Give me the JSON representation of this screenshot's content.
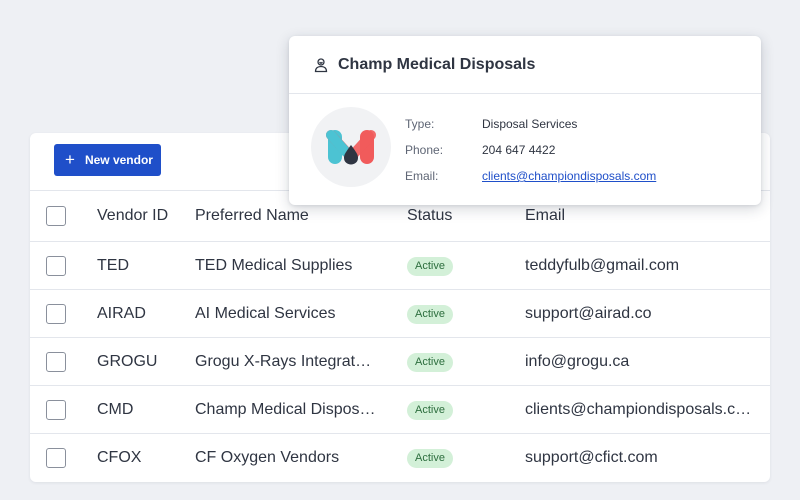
{
  "toolbar": {
    "new_vendor_label": "New vendor"
  },
  "table": {
    "columns": {
      "id": "Vendor ID",
      "name": "Preferred Name",
      "status": "Status",
      "email": "Email"
    },
    "rows": [
      {
        "id": "TED",
        "name": "TED Medical Supplies",
        "status": "Active",
        "email": "teddyfulb@gmail.com"
      },
      {
        "id": "AIRAD",
        "name": "AI Medical Services",
        "status": "Active",
        "email": "support@airad.co"
      },
      {
        "id": "GROGU",
        "name": "Grogu X-Rays Integrat…",
        "status": "Active",
        "email": "info@grogu.ca"
      },
      {
        "id": "CMD",
        "name": "Champ Medical Dispos…",
        "status": "Active",
        "email": "clients@championdisposals.c…"
      },
      {
        "id": "CFOX",
        "name": "CF Oxygen Vendors",
        "status": "Active",
        "email": "support@cfict.com"
      }
    ]
  },
  "popover": {
    "title": "Champ Medical Disposals",
    "type_label": "Type:",
    "type_value": "Disposal Services",
    "phone_label": "Phone:",
    "phone_value": "204 647 4422",
    "email_label": "Email:",
    "email_value": "clients@championdisposals.com"
  },
  "colors": {
    "primary": "#1f4fc9",
    "badge_bg": "#d3f0d8",
    "badge_text": "#2d6e3e",
    "logo_teal": "#4cc3d3",
    "logo_red": "#f15b5b",
    "logo_dark": "#2f3542"
  }
}
